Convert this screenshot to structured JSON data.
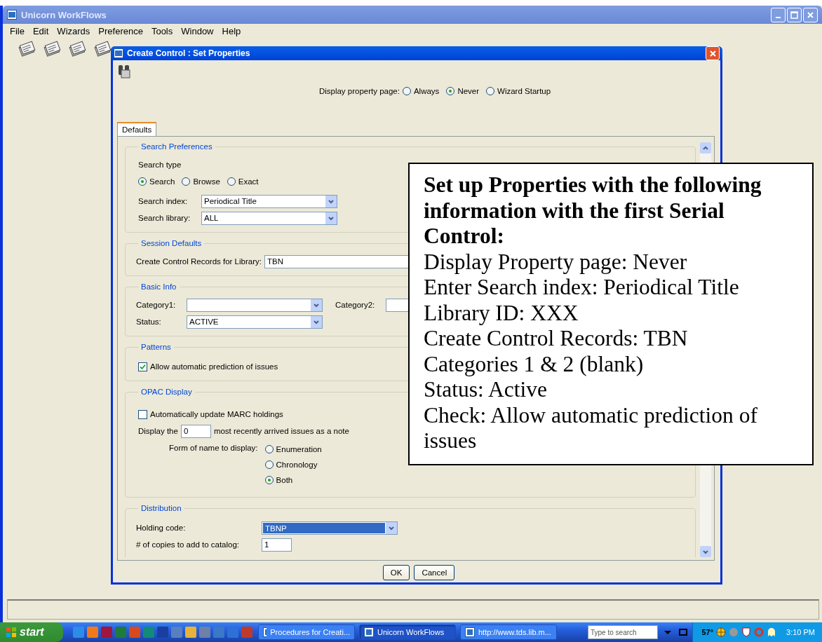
{
  "window": {
    "title": "Unicorn WorkFlows"
  },
  "menu": [
    {
      "label": "File"
    },
    {
      "label": "Edit"
    },
    {
      "label": "Wizards"
    },
    {
      "label": "Preference"
    },
    {
      "label": "Tools"
    },
    {
      "label": "Window"
    },
    {
      "label": "Help"
    }
  ],
  "dialog": {
    "title": "Create Control : Set Properties",
    "display_property": {
      "label": "Display property page:",
      "options": [
        {
          "label": "Always",
          "selected": false
        },
        {
          "label": "Never",
          "selected": true
        },
        {
          "label": "Wizard Startup",
          "selected": false
        }
      ]
    },
    "tabs": [
      {
        "label": "Defaults",
        "selected": true
      }
    ],
    "search_preferences": {
      "title": "Search Preferences",
      "search_type_label": "Search type",
      "search_type": [
        {
          "label": "Search",
          "selected": true
        },
        {
          "label": "Browse",
          "selected": false
        },
        {
          "label": "Exact",
          "selected": false
        }
      ],
      "search_index": {
        "label": "Search index:",
        "value": "Periodical Title"
      },
      "search_library": {
        "label": "Search library:",
        "value": "ALL"
      }
    },
    "session_defaults": {
      "title": "Session Defaults",
      "create_control_records": {
        "label": "Create Control Records for Library:",
        "value": "TBN"
      }
    },
    "basic_info": {
      "title": "Basic Info",
      "category1": {
        "label": "Category1:"
      },
      "category2": {
        "label": "Category2:"
      },
      "status": {
        "label": "Status:",
        "value": "ACTIVE"
      }
    },
    "patterns": {
      "title": "Patterns",
      "allow_prediction": {
        "label": "Allow automatic prediction of issues",
        "checked": true
      }
    },
    "opac_display": {
      "title": "OPAC Display",
      "auto_update": {
        "label": "Automatically update MARC holdings",
        "checked": false
      },
      "display_the": {
        "label_before": "Display the",
        "value": "0",
        "label_after": "most recently arrived issues as a note"
      },
      "form_of_name": {
        "label": "Form of name to display:",
        "options": [
          {
            "label": "Enumeration",
            "selected": false
          },
          {
            "label": "Chronology",
            "selected": false
          },
          {
            "label": "Both",
            "selected": true
          }
        ]
      }
    },
    "distribution": {
      "title": "Distribution",
      "holding_code": {
        "label": "Holding code:",
        "value": "TBNP",
        "highlighted": true
      },
      "copies": {
        "label": "# of copies to add to catalog:",
        "value": "1"
      }
    },
    "buttons": [
      {
        "label": "OK"
      },
      {
        "label": "Cancel"
      }
    ]
  },
  "callout": {
    "heading": "Set up Properties with the following information with the first Serial Control:",
    "lines": [
      "Display Property page: Never",
      "Enter Search index: Periodical Title",
      "Library ID: XXX",
      "Create Control Records: TBN",
      "Categories 1 & 2 (blank)",
      "Status: Active",
      "Check: Allow automatic prediction of issues"
    ]
  },
  "taskbar": {
    "start": "start",
    "tasks": [
      {
        "label": "Procedures for Creati...",
        "selected": false
      },
      {
        "label": "Unicorn WorkFlows",
        "selected": true
      },
      {
        "label": "http://www.tds.lib.m...",
        "selected": false
      }
    ],
    "search": {
      "placeholder": "Type to search"
    },
    "temperature": "57°",
    "clock": "3:10 PM"
  }
}
